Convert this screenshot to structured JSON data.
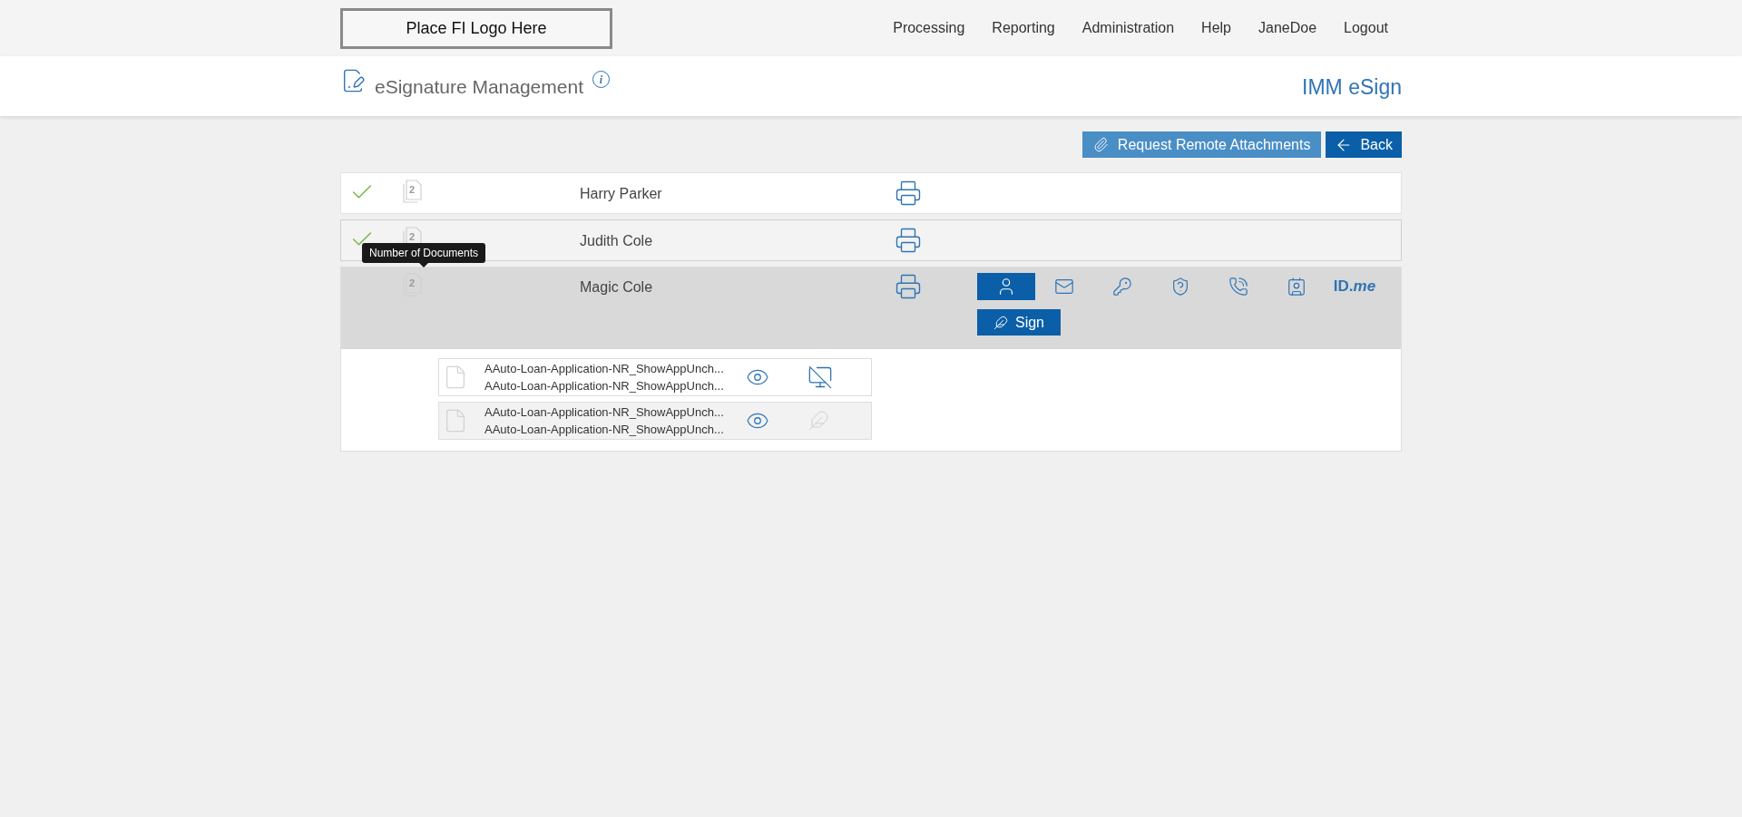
{
  "nav": {
    "logo": "Place FI Logo Here",
    "items": [
      "Processing",
      "Reporting",
      "Administration",
      "Help",
      "JaneDoe",
      "Logout"
    ]
  },
  "header": {
    "title": "eSignature Management",
    "info": "i",
    "brand": "IMM eSign"
  },
  "actions": [
    {
      "kind": "attach",
      "label": "Request Remote Attachments"
    },
    {
      "kind": "back",
      "label": "Back"
    }
  ],
  "signers": [
    {
      "name": "Harry Parker",
      "signed": true,
      "doc_count": "2",
      "hovered": false,
      "expanded": false
    },
    {
      "name": "Judith Cole",
      "signed": true,
      "doc_count": "2",
      "hovered": true,
      "expanded": false
    },
    {
      "name": "Magic Cole",
      "signed": false,
      "doc_count": "2",
      "hovered": false,
      "expanded": true,
      "tooltip": "Number of Documents",
      "auth_methods": [
        {
          "kind": "person",
          "selected": true
        },
        {
          "kind": "mail",
          "selected": false
        },
        {
          "kind": "key",
          "selected": false
        },
        {
          "kind": "shield",
          "selected": false
        },
        {
          "kind": "phone",
          "selected": false
        },
        {
          "kind": "video",
          "selected": false
        },
        {
          "kind": "idme",
          "label": "ID.*me*",
          "selected": false
        }
      ],
      "sign_button": "Sign",
      "documents": [
        {
          "names": [
            "AAuto-Loan-Application-NR_ShowAppUnch...",
            "AAuto-Loan-Application-NR_ShowAppUnch..."
          ],
          "kind": "no-display",
          "highlighted": false
        },
        {
          "names": [
            "AAuto-Loan-Application-NR_ShowAppUnch...",
            "AAuto-Loan-Application-NR_ShowAppUnch..."
          ],
          "kind": "sign-disabled",
          "highlighted": true
        }
      ]
    }
  ]
}
